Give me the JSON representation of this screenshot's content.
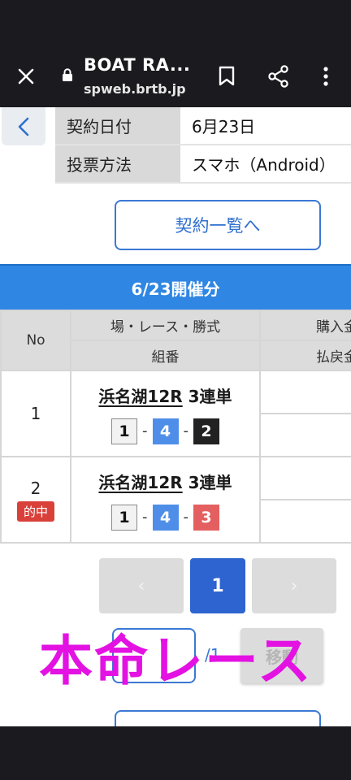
{
  "browser": {
    "title": "BOAT RA...",
    "url": "spweb.brtb.jp"
  },
  "contract": {
    "date_label": "契約日付",
    "date_value": "6月23日",
    "method_label": "投票方法",
    "method_value": "スマホ（Android）"
  },
  "list_button": "契約一覧へ",
  "date_header": "6/23開催分",
  "table": {
    "headers": {
      "no": "No",
      "race": "場・レース・勝式",
      "combo": "組番",
      "buy": "購入金",
      "payout": "払戻金"
    },
    "rows": [
      {
        "no": "1",
        "venue": "浜名湖12R",
        "bet_type": "3連単",
        "combo": [
          "1",
          "4",
          "2"
        ],
        "badge": ""
      },
      {
        "no": "2",
        "venue": "浜名湖12R",
        "bet_type": "3連単",
        "combo": [
          "1",
          "4",
          "3"
        ],
        "badge": "的中"
      }
    ]
  },
  "pager": {
    "prev": "‹",
    "current": "1",
    "next": "›"
  },
  "page_jump": {
    "total": "/1",
    "move": "移動"
  },
  "overlay_caption": "本命レース",
  "colors": {
    "accent_blue": "#2f86e3",
    "hit_red": "#d9403a",
    "caption_magenta": "#e312e3"
  }
}
